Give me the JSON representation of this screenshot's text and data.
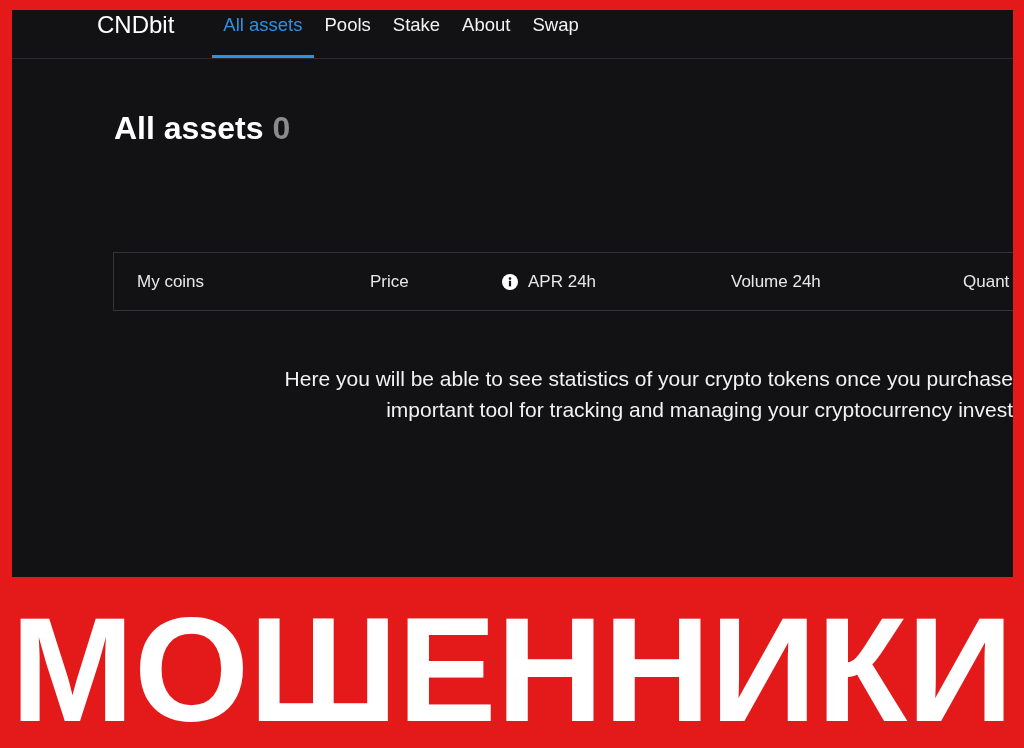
{
  "nav": {
    "logo": "CNDbit",
    "tabs": [
      {
        "label": "All assets",
        "selected": true
      },
      {
        "label": "Pools",
        "selected": false
      },
      {
        "label": "Stake",
        "selected": false
      },
      {
        "label": "About",
        "selected": false
      },
      {
        "label": "Swap",
        "selected": false
      }
    ]
  },
  "heading": {
    "title": "All assets",
    "count": "0"
  },
  "table": {
    "columns": [
      {
        "label": "My coins",
        "info": false
      },
      {
        "label": "Price",
        "info": false
      },
      {
        "label": "APR 24h",
        "info": true
      },
      {
        "label": "Volume 24h",
        "info": false
      },
      {
        "label": "Quant",
        "info": false
      }
    ]
  },
  "empty_message": {
    "lines": [
      "Here you will be able to see statistics of your crypto tokens once you purchase",
      "important tool for tracking and managing your cryptocurrency invest"
    ]
  },
  "banner": {
    "text": "МОШЕННИКИ"
  }
}
